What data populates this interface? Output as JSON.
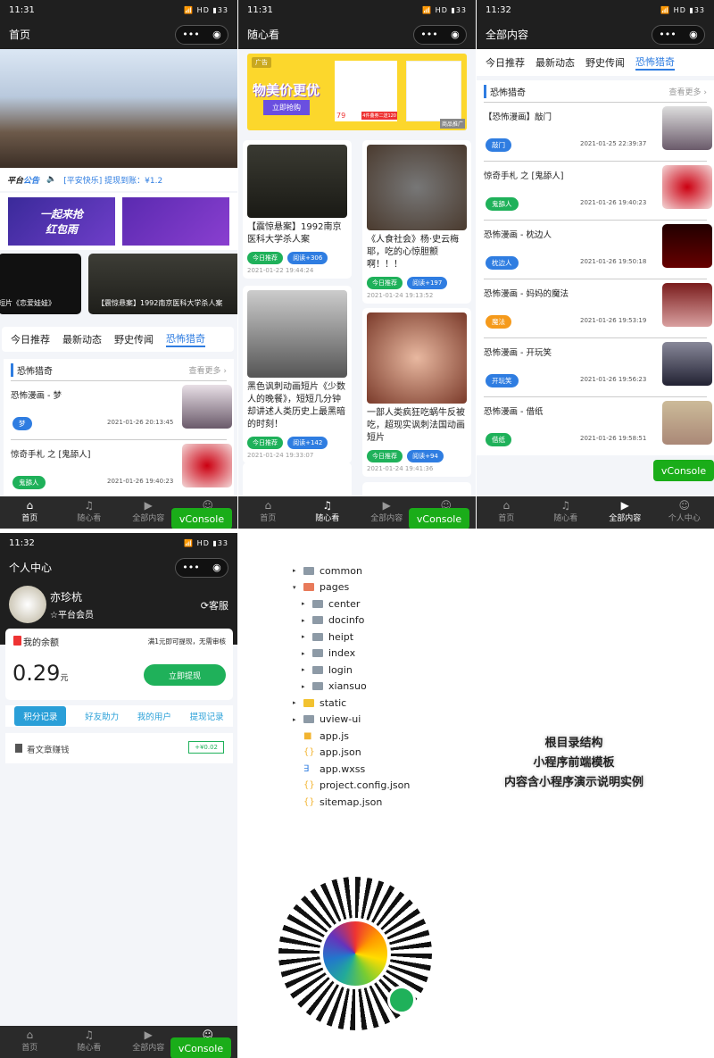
{
  "status": {
    "times": [
      "11:31",
      "11:31",
      "11:32",
      "11:32"
    ],
    "net": "HD",
    "battery": "33"
  },
  "tabbar": [
    "首页",
    "随心看",
    "全部内容",
    "个人中心"
  ],
  "vconsole": "vConsole",
  "capsule": {
    "more": "•••",
    "close": "◉"
  },
  "home": {
    "title": "首页",
    "notice_label_a": "平台",
    "notice_label_b": "公告",
    "notice": "[平安快乐] 提现到账：¥1.2",
    "banner_text": [
      "一起来抢",
      "红包雨"
    ],
    "videos": [
      "短片《恋爱娃娃》",
      "【震惊悬案】1992南京医科大学杀人案"
    ],
    "tabs": [
      "今日推荐",
      "最新动态",
      "野史传闻",
      "恐怖猎奇"
    ],
    "section": "恐怖猎奇",
    "more": "查看更多 ›",
    "items": [
      {
        "title": "恐怖漫画 - 梦",
        "tag": "梦",
        "date": "2021-01-26 20:13:45",
        "color": "#2f7de1"
      },
      {
        "title": "惊奇手札 之 [鬼舔人]",
        "tag": "鬼舔人",
        "date": "2021-01-26 19:40:23",
        "color": "#1fb15a"
      }
    ]
  },
  "feed": {
    "title": "随心看",
    "ad_label": "广告",
    "ad_text": "物美价更优",
    "ad_button": "立即抢购",
    "ad_price": "79",
    "ad_promo": "4件叠券二送120",
    "ad_corner": "商品推广",
    "cards": [
      {
        "title": "【震惊悬案】1992南京医科大学杀人案",
        "tag": "今日推荐",
        "reads": "阅读+306",
        "date": "2021-01-22 19:44:24"
      },
      {
        "title": "《人食社会》杨·史云梅耶，吃的心惊胆颤啊！！！",
        "tag": "今日推荐",
        "reads": "阅读+197",
        "date": "2021-01-24 19:13:52"
      },
      {
        "title": "黑色讽刺动画短片《少数人的晚餐》，短短几分钟却讲述人类历史上最黑暗的时刻！",
        "tag": "今日推荐",
        "reads": "阅读+142",
        "date": "2021-01-24 19:33:07"
      },
      {
        "title": "一部人类疯狂吃蜗牛反被吃，超现实讽刺法国动画短片",
        "tag": "今日推荐",
        "reads": "阅读+94",
        "date": "2021-01-24 19:41:36"
      }
    ]
  },
  "all": {
    "title": "全部内容",
    "tabs": [
      "今日推荐",
      "最新动态",
      "野史传闻",
      "恐怖猎奇"
    ],
    "section": "恐怖猎奇",
    "more": "查看更多 ›",
    "items": [
      {
        "title": "【恐怖漫画】敲门",
        "tag": "敲门",
        "date": "2021-01-25 22:39:37",
        "color": "#2f7de1"
      },
      {
        "title": "惊奇手札 之 [鬼舔人]",
        "tag": "鬼舔人",
        "date": "2021-01-26 19:40:23",
        "color": "#1fb15a"
      },
      {
        "title": "恐怖漫画 - 枕边人",
        "tag": "枕边人",
        "date": "2021-01-26 19:50:18",
        "color": "#2f7de1"
      },
      {
        "title": "恐怖漫画 - 妈妈的魔法",
        "tag": "魔法",
        "date": "2021-01-26 19:53:19",
        "color": "#f59a1b"
      },
      {
        "title": "恐怖漫画 - 开玩笑",
        "tag": "开玩笑",
        "date": "2021-01-26 19:56:23",
        "color": "#2f7de1"
      },
      {
        "title": "恐怖漫画 - 借纸",
        "tag": "借纸",
        "date": "2021-01-26 19:58:51",
        "color": "#1fb15a"
      }
    ]
  },
  "me": {
    "title": "个人中心",
    "name": "亦珍杭",
    "level": "☆平台会员",
    "service": "客服",
    "balance_label": "我的余额",
    "balance_hint": "满1元即可提现，无需审核",
    "balance": "0.29",
    "unit": "元",
    "withdraw": "立即提现",
    "tabs": [
      "积分记录",
      "好友助力",
      "我的用户",
      "提现记录"
    ],
    "record": "看文章赚钱",
    "record_amount": "+¥0.02"
  },
  "tree": [
    {
      "name": "common",
      "lvl": 0,
      "arrow": "▸",
      "kind": "folder"
    },
    {
      "name": "pages",
      "lvl": 0,
      "arrow": "▾",
      "kind": "folder-open"
    },
    {
      "name": "center",
      "lvl": 1,
      "arrow": "▸",
      "kind": "folder"
    },
    {
      "name": "docinfo",
      "lvl": 1,
      "arrow": "▸",
      "kind": "folder"
    },
    {
      "name": "heipt",
      "lvl": 1,
      "arrow": "▸",
      "kind": "folder"
    },
    {
      "name": "index",
      "lvl": 1,
      "arrow": "▸",
      "kind": "folder"
    },
    {
      "name": "login",
      "lvl": 1,
      "arrow": "▸",
      "kind": "folder"
    },
    {
      "name": "xiansuo",
      "lvl": 1,
      "arrow": "▸",
      "kind": "folder"
    },
    {
      "name": "static",
      "lvl": 0,
      "arrow": "▸",
      "kind": "folder-static"
    },
    {
      "name": "uview-ui",
      "lvl": 0,
      "arrow": "▸",
      "kind": "folder"
    },
    {
      "name": "app.js",
      "lvl": 0,
      "arrow": "",
      "kind": "js"
    },
    {
      "name": "app.json",
      "lvl": 0,
      "arrow": "",
      "kind": "json"
    },
    {
      "name": "app.wxss",
      "lvl": 0,
      "arrow": "",
      "kind": "css"
    },
    {
      "name": "project.config.json",
      "lvl": 0,
      "arrow": "",
      "kind": "json"
    },
    {
      "name": "sitemap.json",
      "lvl": 0,
      "arrow": "",
      "kind": "json"
    }
  ],
  "caption": [
    "根目录结构",
    "小程序前端模板",
    "内容含小程序演示说明实例"
  ],
  "colors": {
    "accent": "#2f7de1",
    "green": "#1fb15a",
    "vconsole": "#1aad19",
    "dark": "#1f1f1f"
  }
}
